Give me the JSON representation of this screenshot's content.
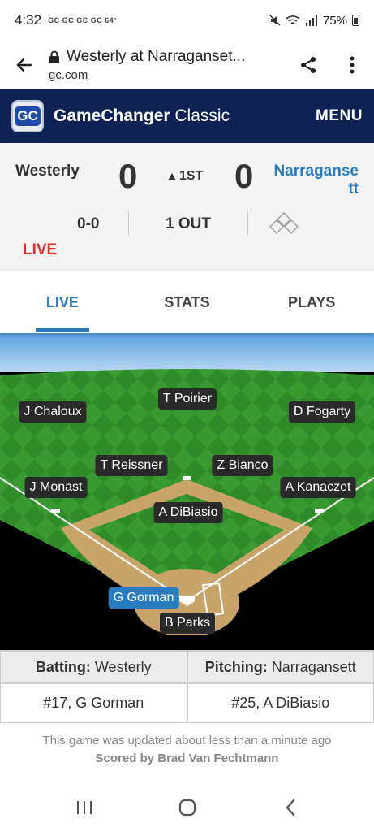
{
  "status_bar": {
    "time": "4:32",
    "notifications": "GC GC GC GC 64°",
    "battery": "75%"
  },
  "browser": {
    "title": "Westerly at Narraganset...",
    "url": "gc.com"
  },
  "app_header": {
    "logo_text": "GC",
    "brand_bold": "GameChanger",
    "brand_light": "Classic",
    "menu_label": "MENU"
  },
  "scoreboard": {
    "away_team": "Westerly",
    "away_score": "0",
    "inning": "1ST",
    "home_score": "0",
    "home_team": "Narraganse tt",
    "count": "0-0",
    "outs": "1 OUT",
    "status": "LIVE"
  },
  "tabs": [
    {
      "label": "LIVE",
      "active": true
    },
    {
      "label": "STATS",
      "active": false
    },
    {
      "label": "PLAYS",
      "active": false
    }
  ],
  "fielders": {
    "cf": "T Poirier",
    "lf": "J Chaloux",
    "rf": "D Fogarty",
    "ss": "T Reissner",
    "2b": "Z Bianco",
    "3b": "J Monast",
    "1b": "A Kanaczet",
    "p": "A DiBiasio",
    "batter": "G Gorman",
    "c": "B Parks"
  },
  "matchup": {
    "batting_label": "Batting:",
    "batting_team": "Westerly",
    "pitching_label": "Pitching:",
    "pitching_team": "Narragansett",
    "batter": "#17, G Gorman",
    "pitcher": "#25, A DiBiasio"
  },
  "footer": {
    "updated": "This game was updated about less than a minute ago",
    "scored_by": "Scored by Brad Van Fechtmann"
  },
  "colors": {
    "header_navy": "#0e2255",
    "accent_blue": "#2a7cc0",
    "live_red": "#e02c2c"
  }
}
